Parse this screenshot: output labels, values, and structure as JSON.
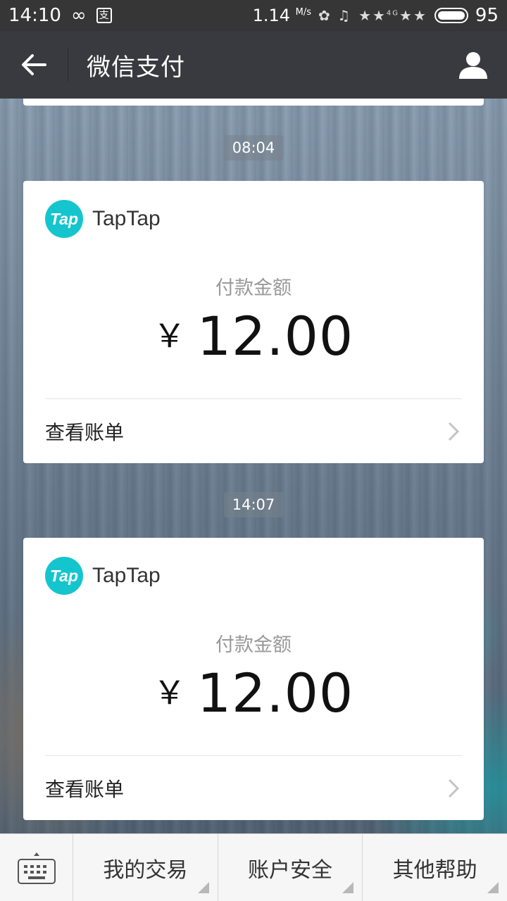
{
  "status_bar": {
    "time": "14:10",
    "speed": "1.14",
    "speed_unit": "M/s",
    "network": "4G",
    "battery": "95"
  },
  "header": {
    "title": "微信支付"
  },
  "messages": [
    {
      "time": "08:04",
      "merchant": "TapTap",
      "logo_text": "Tap",
      "amount_label": "付款金额",
      "currency": "￥",
      "amount": "12.00",
      "action_label": "查看账单"
    },
    {
      "time": "14:07",
      "merchant": "TapTap",
      "logo_text": "Tap",
      "amount_label": "付款金额",
      "currency": "￥",
      "amount": "12.00",
      "action_label": "查看账单"
    }
  ],
  "bottom_menu": {
    "items": [
      {
        "label": "我的交易"
      },
      {
        "label": "账户安全"
      },
      {
        "label": "其他帮助"
      }
    ]
  },
  "colors": {
    "title_bar": "#393a3f",
    "status_bar": "#363636",
    "logo": "#15c5ce"
  }
}
